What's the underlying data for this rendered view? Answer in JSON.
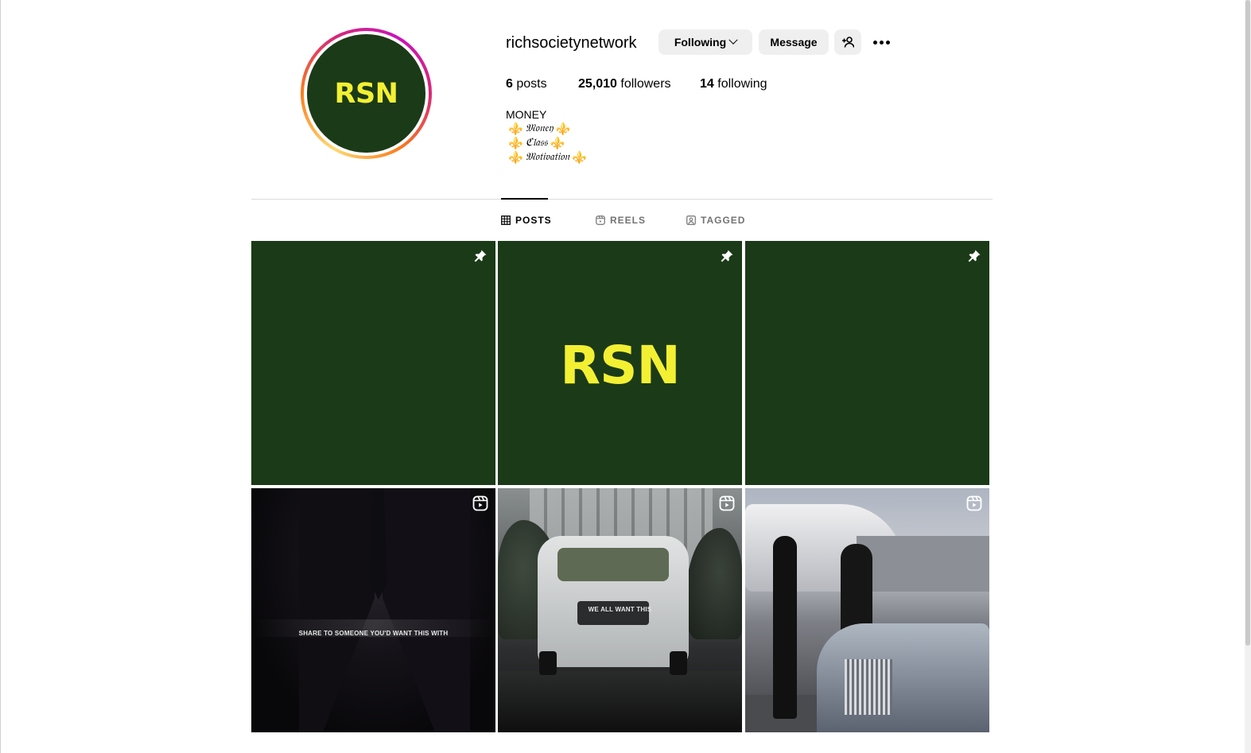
{
  "profile": {
    "avatar_text": "RSN",
    "username": "richsocietynetwork",
    "following_button": "Following",
    "message_button": "Message"
  },
  "stats": {
    "posts_count": "6",
    "posts_label": "posts",
    "followers_count": "25,010",
    "followers_label": "followers",
    "following_count": "14",
    "following_label": "following"
  },
  "bio": {
    "title": "MONEY",
    "lines": [
      "𝔐𝔬𝔫𝔢𝔶",
      "ℭ𝔩𝔞𝔰𝔰",
      "𝔐𝔬𝔱𝔦𝔳𝔞𝔱𝔦𝔬𝔫"
    ],
    "emoji": "⚜️"
  },
  "tabs": {
    "posts": "POSTS",
    "reels": "REELS",
    "tagged": "TAGGED"
  },
  "posts": {
    "post2_text": "RSN",
    "post4_overlay": "SHARE TO SOMEONE YOU'D WANT THIS WITH",
    "post5_overlay": "WE ALL WANT THIS"
  },
  "colors": {
    "brand_green": "#1b3a17",
    "brand_yellow": "#f3f033"
  }
}
